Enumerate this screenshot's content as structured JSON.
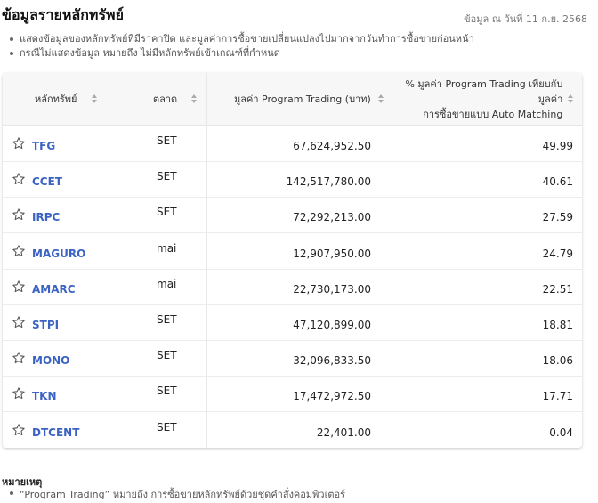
{
  "page": {
    "title": "ข้อมูลรายหลักทรัพย์",
    "as_of": "ข้อมูล ณ วันที่ 11 ก.ย. 2568",
    "notes": [
      "แสดงข้อมูลของหลักทรัพย์ที่มีราคาปิด และมูลค่าการซื้อขายเปลี่ยนแปลงไปมากจากวันทำการซื้อขายก่อนหน้า",
      "กรณีไม่แสดงข้อมูล หมายถึง ไม่มีหลักทรัพย์เข้าเกณฑ์ที่กำหนด"
    ]
  },
  "table": {
    "headers": {
      "symbol": "หลักทรัพย์",
      "market": "ตลาด",
      "value": "มูลค่า Program Trading (บาท)",
      "percent_line1": "% มูลค่า Program Trading เทียบกับมูลค่า",
      "percent_line2": "การซื้อขายแบบ Auto Matching"
    },
    "rows": [
      {
        "symbol": "TFG",
        "market": "SET",
        "value": "67,624,952.50",
        "percent": "49.99"
      },
      {
        "symbol": "CCET",
        "market": "SET",
        "value": "142,517,780.00",
        "percent": "40.61"
      },
      {
        "symbol": "IRPC",
        "market": "SET",
        "value": "72,292,213.00",
        "percent": "27.59"
      },
      {
        "symbol": "MAGURO",
        "market": "mai",
        "value": "12,907,950.00",
        "percent": "24.79"
      },
      {
        "symbol": "AMARC",
        "market": "mai",
        "value": "22,730,173.00",
        "percent": "22.51"
      },
      {
        "symbol": "STPI",
        "market": "SET",
        "value": "47,120,899.00",
        "percent": "18.81"
      },
      {
        "symbol": "MONO",
        "market": "SET",
        "value": "32,096,833.50",
        "percent": "18.06"
      },
      {
        "symbol": "TKN",
        "market": "SET",
        "value": "17,472,972.50",
        "percent": "17.71"
      },
      {
        "symbol": "DTCENT",
        "market": "SET",
        "value": "22,401.00",
        "percent": "0.04"
      }
    ]
  },
  "remarks": {
    "title": "หมายเหตุ",
    "items": [
      "“Program Trading” หมายถึง การซื้อขายหลักทรัพย์ด้วยชุดคำสั่งคอมพิวเตอร์"
    ]
  },
  "colors": {
    "symbol_link": "#3b63c4",
    "header_bg": "#f7f7f8",
    "star_outline": "#555555"
  },
  "icons": {
    "star": "star-outline-icon",
    "sort": "sort-icon"
  }
}
